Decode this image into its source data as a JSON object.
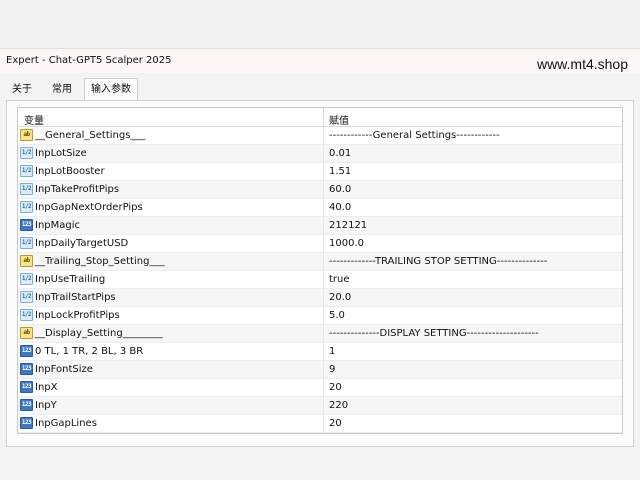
{
  "window": {
    "title": "Expert - Chat-GPT5 Scalper 2025",
    "watermark": "www.mt4.shop"
  },
  "tabs": [
    {
      "label": "关于",
      "active": false
    },
    {
      "label": "常用",
      "active": false
    },
    {
      "label": "输入参数",
      "active": true
    }
  ],
  "table": {
    "headers": {
      "variable": "变量",
      "value": "赋值"
    },
    "rows": [
      {
        "icon": "string-icon",
        "type": "ab",
        "name": "__General_Settings___",
        "value": "------------General Settings------------"
      },
      {
        "icon": "double-icon",
        "type": "dbl",
        "name": "InpLotSize",
        "value": "0.01"
      },
      {
        "icon": "double-icon",
        "type": "dbl",
        "name": "InpLotBooster",
        "value": "1.51"
      },
      {
        "icon": "double-icon",
        "type": "dbl",
        "name": "InpTakeProfitPips",
        "value": "60.0"
      },
      {
        "icon": "double-icon",
        "type": "dbl",
        "name": "InpGapNextOrderPips",
        "value": "40.0"
      },
      {
        "icon": "integer-icon",
        "type": "int",
        "name": "InpMagic",
        "value": "212121"
      },
      {
        "icon": "double-icon",
        "type": "dbl",
        "name": "InpDailyTargetUSD",
        "value": "1000.0"
      },
      {
        "icon": "string-icon",
        "type": "ab",
        "name": "__Trailing_Stop_Setting___",
        "value": "-------------TRAILING STOP SETTING--------------"
      },
      {
        "icon": "boolean-icon",
        "type": "bool",
        "name": "InpUseTrailing",
        "value": "true"
      },
      {
        "icon": "double-icon",
        "type": "dbl",
        "name": "InpTrailStartPips",
        "value": "20.0"
      },
      {
        "icon": "double-icon",
        "type": "dbl",
        "name": "InpLockProfitPips",
        "value": "5.0"
      },
      {
        "icon": "string-icon",
        "type": "ab",
        "name": "__Display_Setting________",
        "value": "--------------DISPLAY SETTING--------------------"
      },
      {
        "icon": "integer-icon",
        "type": "int",
        "name": "0 TL, 1 TR, 2 BL, 3 BR",
        "value": "1"
      },
      {
        "icon": "integer-icon",
        "type": "int",
        "name": "InpFontSize",
        "value": "9"
      },
      {
        "icon": "integer-icon",
        "type": "int",
        "name": "InpX",
        "value": "20"
      },
      {
        "icon": "integer-icon",
        "type": "int",
        "name": "InpY",
        "value": "220"
      },
      {
        "icon": "integer-icon",
        "type": "int",
        "name": "InpGapLines",
        "value": "20"
      }
    ]
  },
  "icon_glyphs": {
    "ab": "ab",
    "dbl": "1/2",
    "int": "123",
    "bool": "1/2"
  },
  "colors": {
    "title_bg": "#fdf6f6",
    "row_alt": "#f6f6f6",
    "int_icon": "#3d78c6",
    "string_icon": "#f7e58a"
  }
}
